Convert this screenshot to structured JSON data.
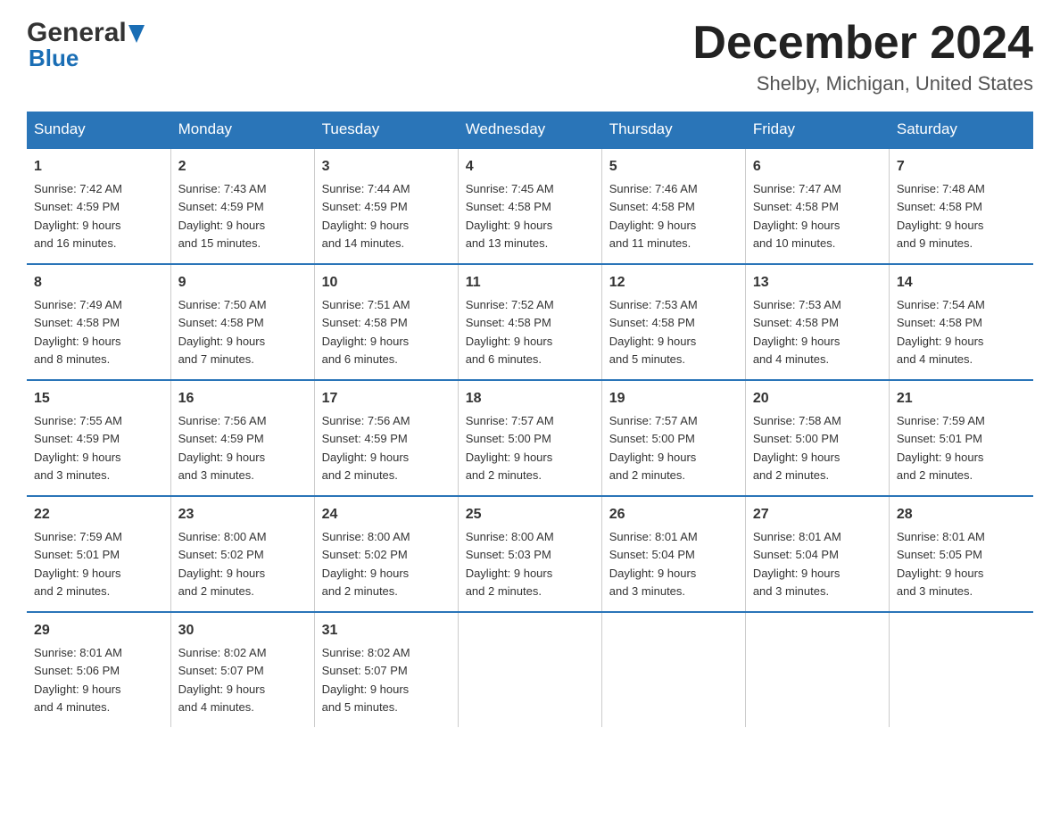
{
  "logo": {
    "general": "General",
    "blue": "Blue"
  },
  "header": {
    "month": "December 2024",
    "location": "Shelby, Michigan, United States"
  },
  "days_of_week": [
    "Sunday",
    "Monday",
    "Tuesday",
    "Wednesday",
    "Thursday",
    "Friday",
    "Saturday"
  ],
  "weeks": [
    [
      {
        "day": "1",
        "sunrise": "7:42 AM",
        "sunset": "4:59 PM",
        "daylight": "9 hours and 16 minutes."
      },
      {
        "day": "2",
        "sunrise": "7:43 AM",
        "sunset": "4:59 PM",
        "daylight": "9 hours and 15 minutes."
      },
      {
        "day": "3",
        "sunrise": "7:44 AM",
        "sunset": "4:59 PM",
        "daylight": "9 hours and 14 minutes."
      },
      {
        "day": "4",
        "sunrise": "7:45 AM",
        "sunset": "4:58 PM",
        "daylight": "9 hours and 13 minutes."
      },
      {
        "day": "5",
        "sunrise": "7:46 AM",
        "sunset": "4:58 PM",
        "daylight": "9 hours and 11 minutes."
      },
      {
        "day": "6",
        "sunrise": "7:47 AM",
        "sunset": "4:58 PM",
        "daylight": "9 hours and 10 minutes."
      },
      {
        "day": "7",
        "sunrise": "7:48 AM",
        "sunset": "4:58 PM",
        "daylight": "9 hours and 9 minutes."
      }
    ],
    [
      {
        "day": "8",
        "sunrise": "7:49 AM",
        "sunset": "4:58 PM",
        "daylight": "9 hours and 8 minutes."
      },
      {
        "day": "9",
        "sunrise": "7:50 AM",
        "sunset": "4:58 PM",
        "daylight": "9 hours and 7 minutes."
      },
      {
        "day": "10",
        "sunrise": "7:51 AM",
        "sunset": "4:58 PM",
        "daylight": "9 hours and 6 minutes."
      },
      {
        "day": "11",
        "sunrise": "7:52 AM",
        "sunset": "4:58 PM",
        "daylight": "9 hours and 6 minutes."
      },
      {
        "day": "12",
        "sunrise": "7:53 AM",
        "sunset": "4:58 PM",
        "daylight": "9 hours and 5 minutes."
      },
      {
        "day": "13",
        "sunrise": "7:53 AM",
        "sunset": "4:58 PM",
        "daylight": "9 hours and 4 minutes."
      },
      {
        "day": "14",
        "sunrise": "7:54 AM",
        "sunset": "4:58 PM",
        "daylight": "9 hours and 4 minutes."
      }
    ],
    [
      {
        "day": "15",
        "sunrise": "7:55 AM",
        "sunset": "4:59 PM",
        "daylight": "9 hours and 3 minutes."
      },
      {
        "day": "16",
        "sunrise": "7:56 AM",
        "sunset": "4:59 PM",
        "daylight": "9 hours and 3 minutes."
      },
      {
        "day": "17",
        "sunrise": "7:56 AM",
        "sunset": "4:59 PM",
        "daylight": "9 hours and 2 minutes."
      },
      {
        "day": "18",
        "sunrise": "7:57 AM",
        "sunset": "5:00 PM",
        "daylight": "9 hours and 2 minutes."
      },
      {
        "day": "19",
        "sunrise": "7:57 AM",
        "sunset": "5:00 PM",
        "daylight": "9 hours and 2 minutes."
      },
      {
        "day": "20",
        "sunrise": "7:58 AM",
        "sunset": "5:00 PM",
        "daylight": "9 hours and 2 minutes."
      },
      {
        "day": "21",
        "sunrise": "7:59 AM",
        "sunset": "5:01 PM",
        "daylight": "9 hours and 2 minutes."
      }
    ],
    [
      {
        "day": "22",
        "sunrise": "7:59 AM",
        "sunset": "5:01 PM",
        "daylight": "9 hours and 2 minutes."
      },
      {
        "day": "23",
        "sunrise": "8:00 AM",
        "sunset": "5:02 PM",
        "daylight": "9 hours and 2 minutes."
      },
      {
        "day": "24",
        "sunrise": "8:00 AM",
        "sunset": "5:02 PM",
        "daylight": "9 hours and 2 minutes."
      },
      {
        "day": "25",
        "sunrise": "8:00 AM",
        "sunset": "5:03 PM",
        "daylight": "9 hours and 2 minutes."
      },
      {
        "day": "26",
        "sunrise": "8:01 AM",
        "sunset": "5:04 PM",
        "daylight": "9 hours and 3 minutes."
      },
      {
        "day": "27",
        "sunrise": "8:01 AM",
        "sunset": "5:04 PM",
        "daylight": "9 hours and 3 minutes."
      },
      {
        "day": "28",
        "sunrise": "8:01 AM",
        "sunset": "5:05 PM",
        "daylight": "9 hours and 3 minutes."
      }
    ],
    [
      {
        "day": "29",
        "sunrise": "8:01 AM",
        "sunset": "5:06 PM",
        "daylight": "9 hours and 4 minutes."
      },
      {
        "day": "30",
        "sunrise": "8:02 AM",
        "sunset": "5:07 PM",
        "daylight": "9 hours and 4 minutes."
      },
      {
        "day": "31",
        "sunrise": "8:02 AM",
        "sunset": "5:07 PM",
        "daylight": "9 hours and 5 minutes."
      },
      null,
      null,
      null,
      null
    ]
  ],
  "labels": {
    "sunrise": "Sunrise:",
    "sunset": "Sunset:",
    "daylight": "Daylight:"
  }
}
